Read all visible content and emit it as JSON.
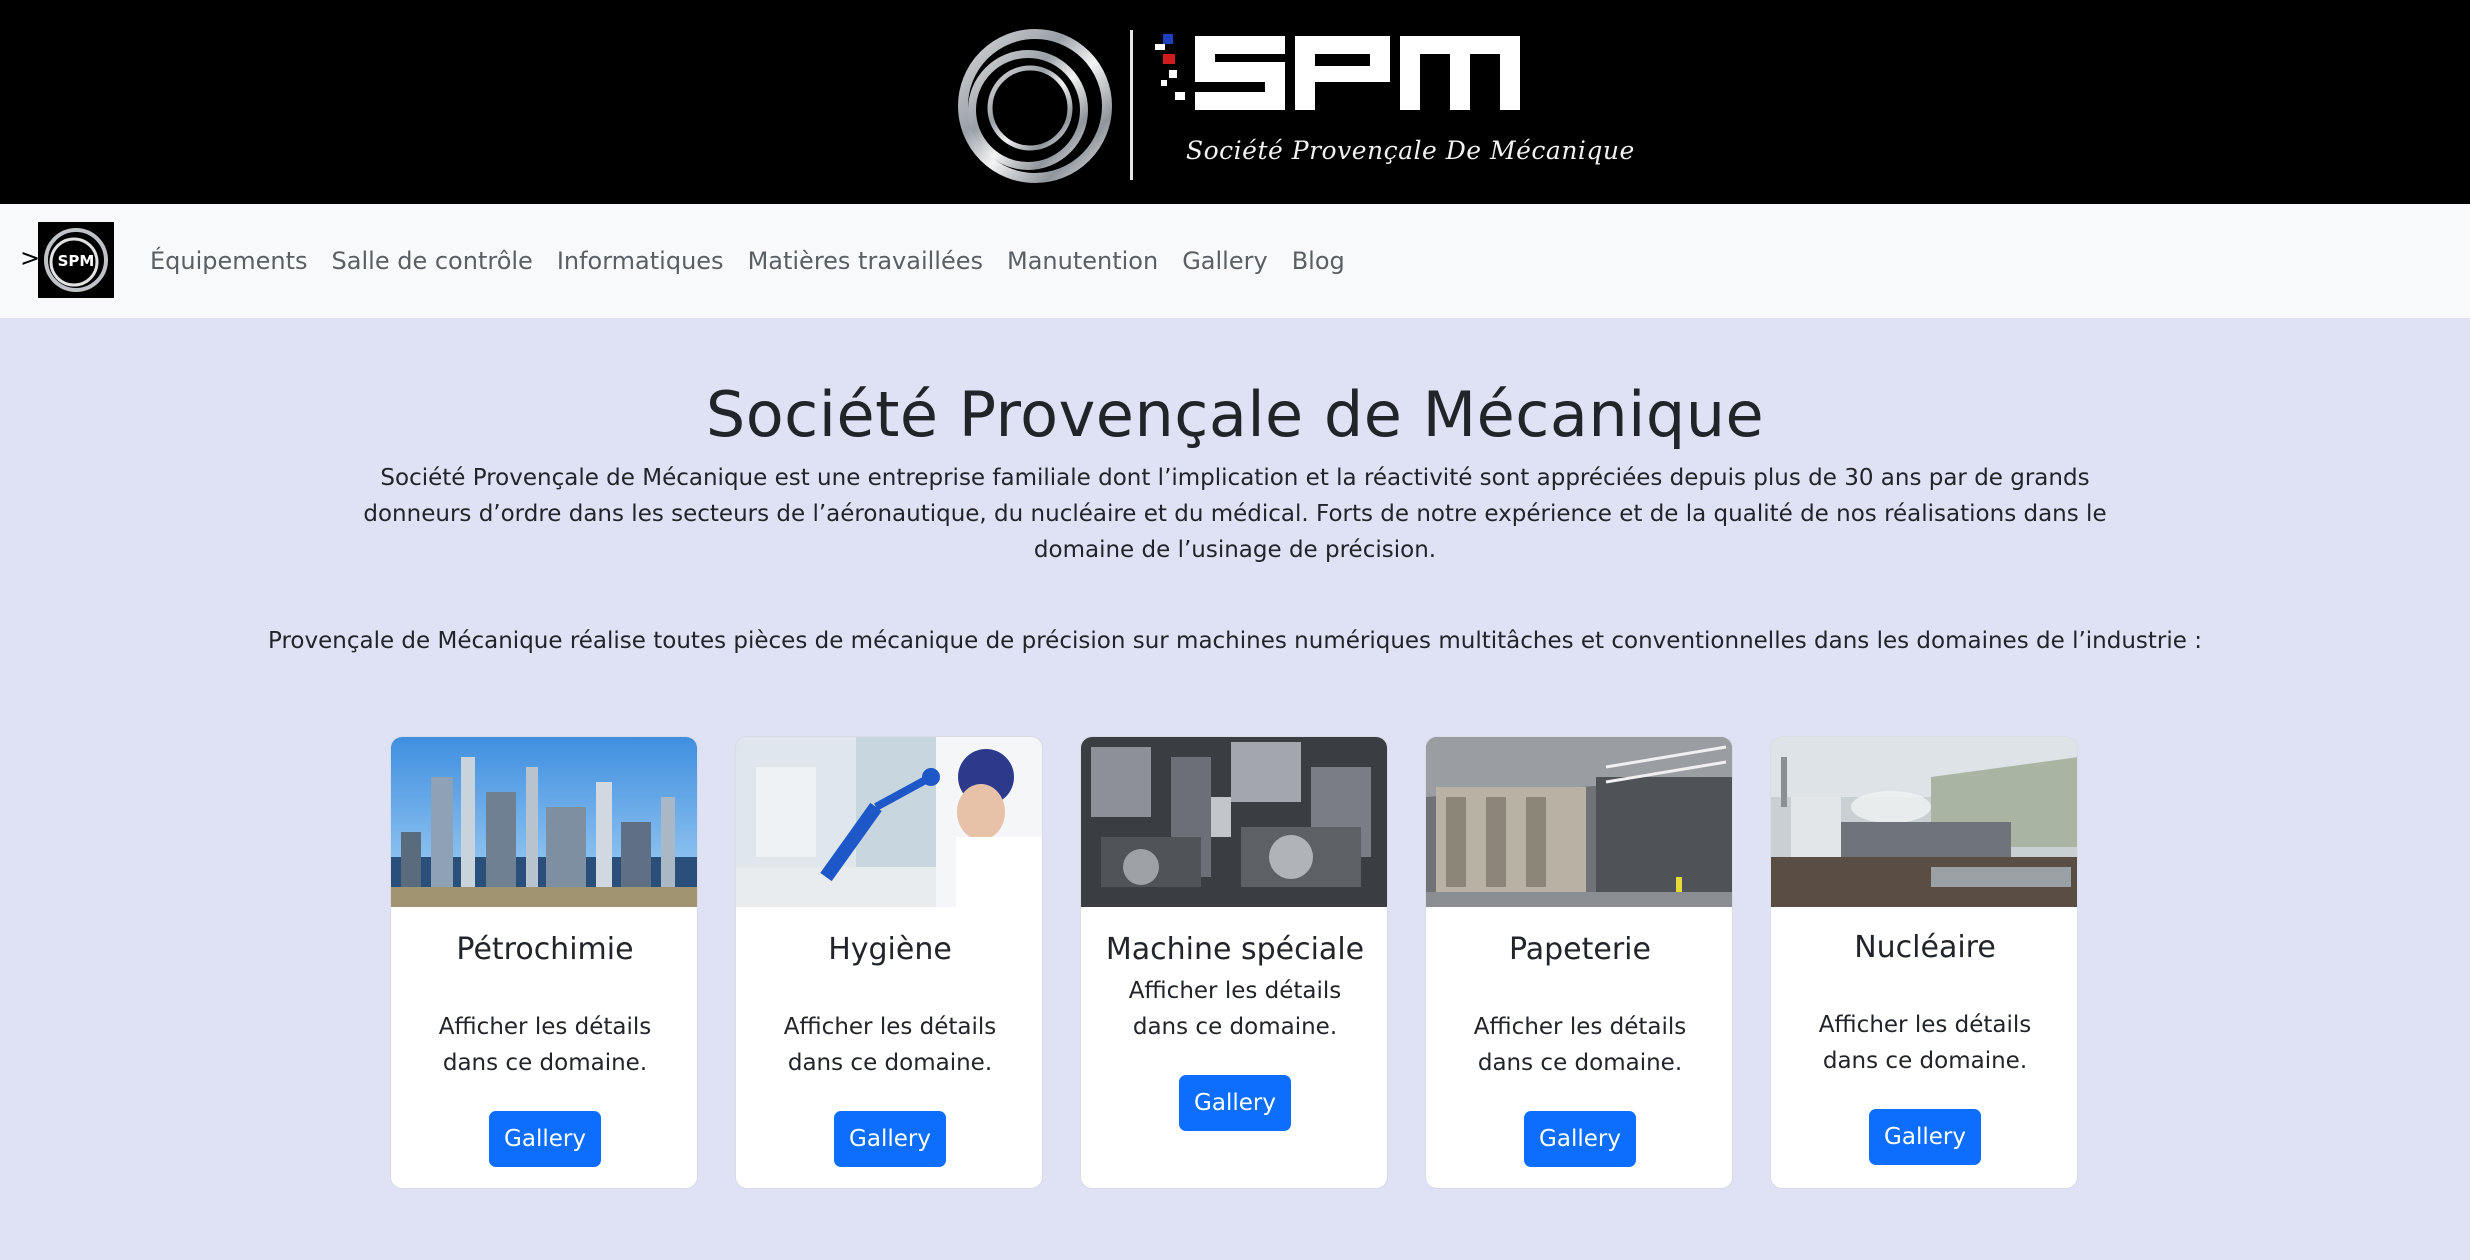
{
  "banner": {
    "logo_text": "SPM",
    "logo_subtitle": "Société Provençale De Mécanique",
    "colors": {
      "background": "#000000",
      "logo": "#ffffff",
      "flag_blue": "#1f3fbf",
      "flag_red": "#d01c1c"
    }
  },
  "navbar": {
    "toggler": ">",
    "logo_text": "SPM",
    "links": [
      {
        "label": "Équipements"
      },
      {
        "label": "Salle de contrôle"
      },
      {
        "label": "Informatiques"
      },
      {
        "label": "Matières travaillées"
      },
      {
        "label": "Manutention"
      },
      {
        "label": "Gallery"
      },
      {
        "label": "Blog"
      }
    ]
  },
  "main": {
    "title": "Société Provençale de Mécanique",
    "intro": "Société Provençale de Mécanique est une entreprise familiale dont l’implication et la réactivité sont appréciées depuis plus de 30 ans par de grands donneurs d’ordre dans les secteurs de l’aéronautique, du nucléaire et du médical. Forts de notre expérience et de la qualité de nos réalisations dans le domaine de l’usinage de précision.",
    "domains_line": "Provençale de Mécanique réalise toutes pièces de mécanique de précision sur machines numériques multitâches et conventionnelles dans les domaines de l’industrie :",
    "cards": [
      {
        "title": "Pétrochimie",
        "text": "Afficher les détails dans ce domaine.",
        "button": "Gallery",
        "image": "petrochemical-plant-photo"
      },
      {
        "title": "Hygiène",
        "text": "Afficher les détails dans ce domaine.",
        "button": "Gallery",
        "image": "hygiene-lab-photo"
      },
      {
        "title": "Machine spéciale",
        "text": "Afficher les détails dans ce domaine.",
        "button": "Gallery",
        "image": "special-machine-photo"
      },
      {
        "title": "Papeterie",
        "text": "Afficher les détails dans ce domaine.",
        "button": "Gallery",
        "image": "paper-mill-photo"
      },
      {
        "title": "Nucléaire",
        "text": "Afficher les détails dans ce domaine.",
        "button": "Gallery",
        "image": "nuclear-plant-photo"
      }
    ]
  },
  "theme": {
    "page_bg": "#dfe1f4",
    "navbar_bg": "#f8f9fa",
    "button_bg": "#0d6efd",
    "button_text": "#ffffff"
  }
}
